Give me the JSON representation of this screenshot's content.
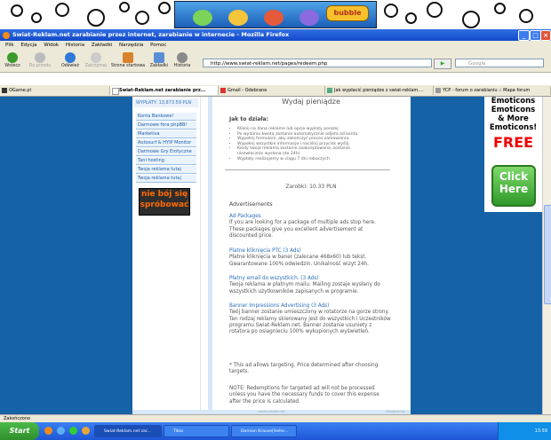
{
  "banner": {
    "logo": "bubble"
  },
  "window": {
    "title": "Swiat-Reklam.net zarabianie przez internet, zarabianie w internecie - Mozilla Firefox"
  },
  "menu": [
    "Plik",
    "Edycja",
    "Widok",
    "Historia",
    "Zakładki",
    "Narzędzia",
    "Pomoc"
  ],
  "toolbar": {
    "back": "Wstecz",
    "forward": "Do przodu",
    "reload": "Odśwież",
    "stop": "Zatrzymaj",
    "home": "Strona startowa",
    "bookmarks": "Zakładki",
    "history": "Historia",
    "address": "http://www.swiat-reklam.net/pages/redeem.php",
    "search_placeholder": "Google"
  },
  "tabs": [
    {
      "label": "OGame.pl"
    },
    {
      "label": "Swiat-Reklam.net zarabianie prz..."
    },
    {
      "label": "Gmail - Odebrane"
    },
    {
      "label": "Jak wypłacić pieniądze z swiat-reklam...."
    },
    {
      "label": "YCP - forum o zarabianiu :: Mapa forum"
    }
  ],
  "sidebar": {
    "wallet": "WYPŁATY: 13,873.59 PLN",
    "items": [
      "Konta Bankowe!",
      "Darmowe fora phpBB!",
      "Marketiva",
      "Autosurf & HYIP Monitor",
      "Darmowe Gry Erotyczne",
      "Tani hosting",
      "Twoja reklama tutaj",
      "Twoja reklama tutaj"
    ],
    "sticker": "nie bój się spróbować"
  },
  "main": {
    "title": "Wydaj pieniądze",
    "howto": "Jak to działa:",
    "steps": [
      "Kliknij na dana reklame lub opcje wyplaty ponizej",
      "Po wydaniu kwota zostanie automatycznie odjeta od konta.",
      "Wypełnij formularz, aby zakończyć proces zamowienia.",
      "Wypełnij wszystkie informacje i naciśnij przycisk wyślij.",
      "Kiedy twoja reklama zostanie zaakceptowana, zostanie",
      "niezwłocznie wysłana (do 24h)",
      "Wypłaty realizujemy w ciągu 7 dni roboczych"
    ],
    "earnings": "Zarobki: 10.33 PLN",
    "advertisements": "Advertisements",
    "packages": [
      {
        "title": "Ad Packages",
        "body": "If you are looking for a package of multiple ads stop here. These packages give you excellent advertisement at discounted price."
      },
      {
        "title": "Platne kliknięcia PTC (3 Ads)",
        "body": "Płatne kliknięcia w baner (zalecane 468x60) lub tekst. Gwarantowane 100% odwiedzin. Unikalność wizyt 24h."
      },
      {
        "title": "Płatny email do wszystkich. (3 Ads)",
        "body": "Twoja reklama w płatnym mailu. Mailing zostaje wysłany do wszystkich użytkowników zapisanych w programie."
      },
      {
        "title": "Banner Impressions Advertising (3 Ads)",
        "body": "Twój banner zostanie umieszczony w rotatorze na gorze strony. Ten rodzaj reklamy skierowany jest do wszystkich i Uczestników programu Swiat-Reklam.net. Banner zostanie usuniety z rotatora po osiagnieciu 100% wykupionych wyświetleń."
      }
    ],
    "note1": "* This ad allows targeting. Price determined after choosing targets.",
    "note2": "NOTE: Redemptions for targeted ad will not be processed unless you have the necessary funds to cover this expense after the price is calculated."
  },
  "footer": {
    "stripe": "swiat-reklam.net",
    "designed": "Designed by"
  },
  "rightad": {
    "line1": "Emoticons",
    "line2": "Emoticons",
    "line3": "& More",
    "line4": "Emoticons!",
    "free": "FREE",
    "click1": "Click",
    "click2": "Here"
  },
  "status": "Zakończono",
  "taskbar": {
    "start": "Start",
    "tasks": [
      "Swiat-Reklam.net zar...",
      "Tibia",
      "Damian Krause[Hehe..."
    ],
    "time": "13:59"
  }
}
